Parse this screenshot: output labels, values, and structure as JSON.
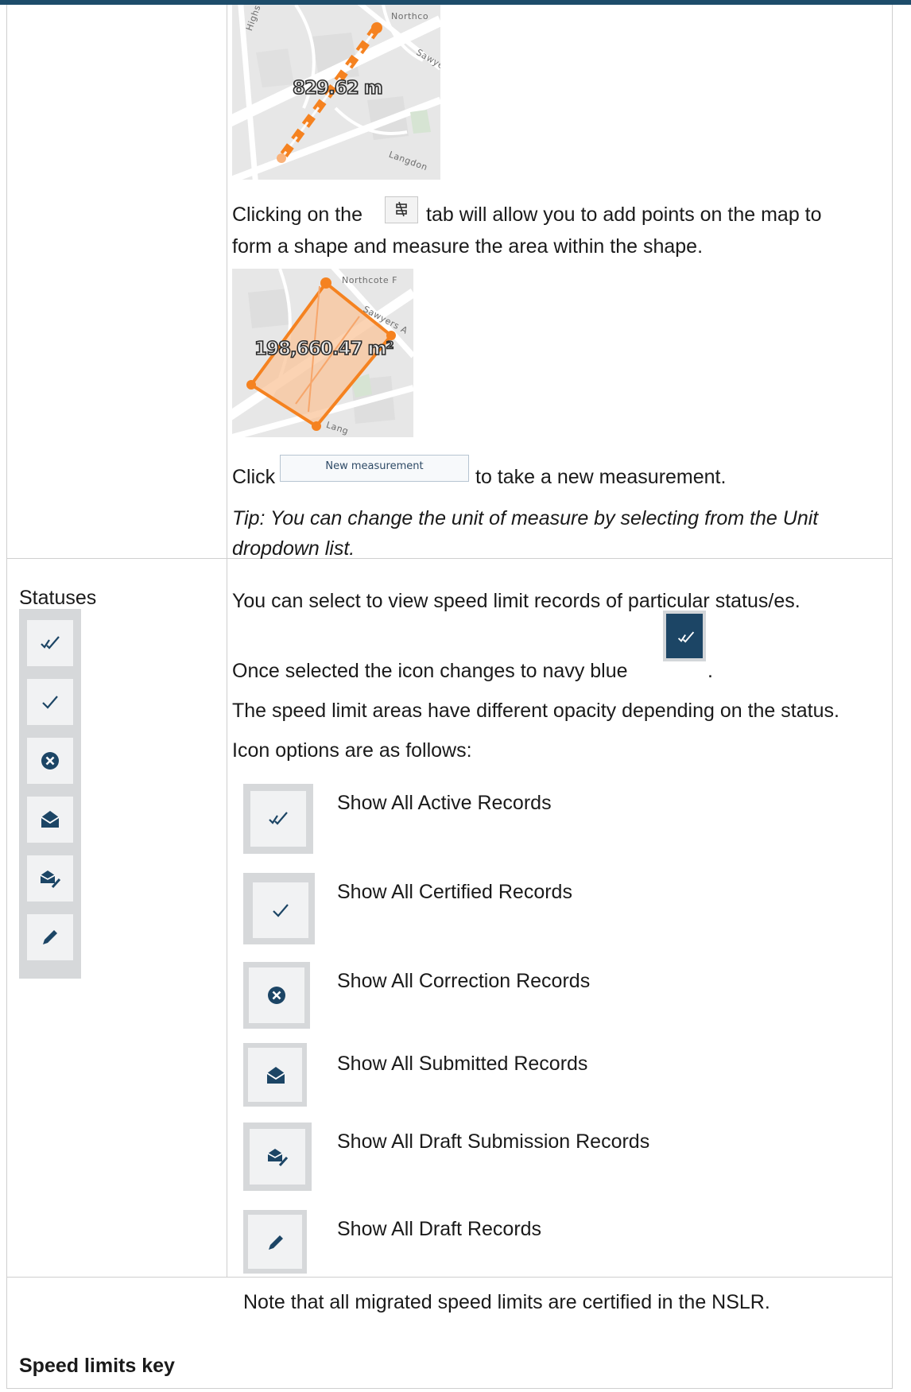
{
  "map_line": {
    "labels": [
      "Highs",
      "Northco",
      "Sawye",
      "Langdon"
    ],
    "measurement": "829.62 m"
  },
  "area_intro": {
    "before_icon": "Clicking on the",
    "after_icon": "tab will allow you to add points on the map to",
    "line2": "form a shape and measure the area within the shape.",
    "icon": "area-measure-icon"
  },
  "map_area": {
    "labels": [
      "Northcote F",
      "Sawyers A",
      "Lang"
    ],
    "measurement": "198,660.47 m²"
  },
  "new_measure": {
    "before": "Click",
    "button_label": "New measurement",
    "after": "to take a new measurement."
  },
  "tip": {
    "line1": "Tip: You can change the unit of measure by selecting from the Unit",
    "line2": "dropdown list."
  },
  "statuses": {
    "heading": "Statuses",
    "intro": "You can select to view speed limit records of particular status/es.",
    "selected_text": "Once selected the icon changes to navy blue",
    "selected_suffix": ".",
    "opacity_text": "The speed limit areas have different opacity depending on the status.",
    "options_intro": "Icon options are as follows:",
    "selected_color": "#1c4565",
    "icons": [
      "double-check-icon",
      "check-icon",
      "x-circle-icon",
      "envelope-open-icon",
      "envelope-edit-icon",
      "pencil-icon"
    ],
    "options": [
      {
        "label": "Show All Active Records",
        "icon": "double-check-icon"
      },
      {
        "label": "Show All Certified Records",
        "icon": "check-icon"
      },
      {
        "label": "Show All Correction Records",
        "icon": "x-circle-icon"
      },
      {
        "label": "Show All Submitted Records",
        "icon": "envelope-open-icon"
      },
      {
        "label": "Show All Draft Submission Records",
        "icon": "envelope-edit-icon"
      },
      {
        "label": "Show All Draft Records",
        "icon": "pencil-icon"
      }
    ],
    "note": "Note that all migrated speed limits are certified in the NSLR."
  },
  "speed_limits_key": {
    "heading": "Speed limits key"
  },
  "colors": {
    "accent_orange": "#f58220",
    "navy": "#1c4565",
    "border": "#cfcfcf"
  }
}
